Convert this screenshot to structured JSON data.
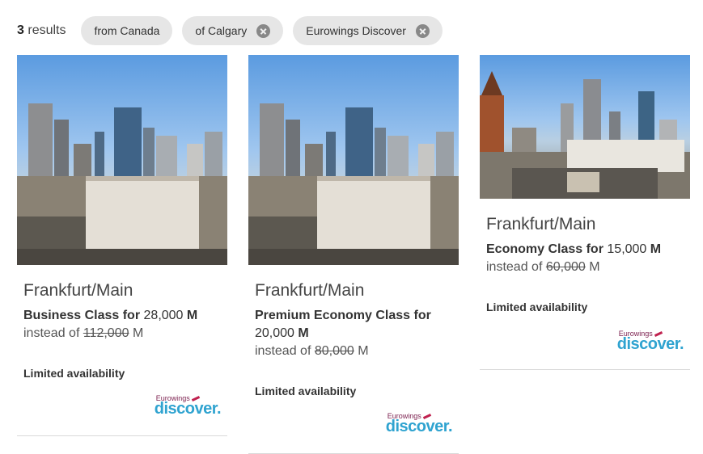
{
  "results": {
    "count": "3",
    "label": "results"
  },
  "filters": [
    {
      "label": "from Canada",
      "removable": false
    },
    {
      "label": "of Calgary",
      "removable": true
    },
    {
      "label": "Eurowings Discover",
      "removable": true
    }
  ],
  "cards": [
    {
      "title": "Frankfurt/Main",
      "class_text": "Business Class for",
      "price": "28,000",
      "instead_prefix": "instead of",
      "old_price": "112,000",
      "miles_symbol": "M",
      "availability": "Limited availability",
      "logo_small": "Eurowings",
      "logo_big": "discover.",
      "image": "frankfurt-skyline-photo"
    },
    {
      "title": "Frankfurt/Main",
      "class_text": "Premium Economy Class for",
      "price": "20,000",
      "instead_prefix": "instead of",
      "old_price": "80,000",
      "miles_symbol": "M",
      "availability": "Limited availability",
      "logo_small": "Eurowings",
      "logo_big": "discover.",
      "image": "frankfurt-skyline-photo"
    },
    {
      "title": "Frankfurt/Main",
      "class_text": "Economy Class for",
      "price": "15,000",
      "instead_prefix": "instead of",
      "old_price": "60,000",
      "miles_symbol": "M",
      "availability": "Limited availability",
      "logo_small": "Eurowings",
      "logo_big": "discover.",
      "image": "frankfurt-street-photo"
    }
  ],
  "colors": {
    "chip_bg": "#e6e6e6",
    "logo_blue": "#2fa3d0",
    "logo_red": "#c0214f"
  }
}
